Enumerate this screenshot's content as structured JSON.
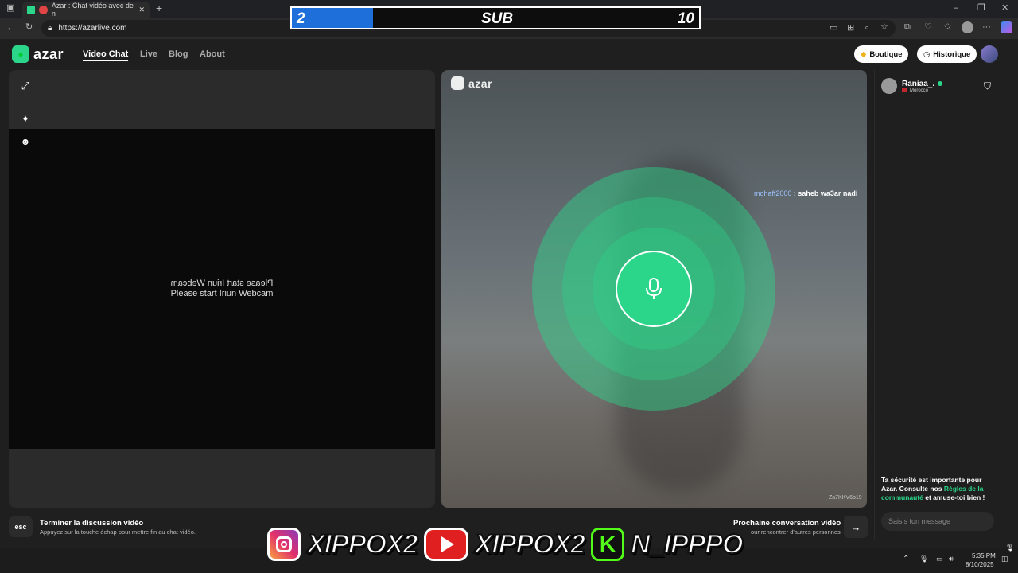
{
  "browser": {
    "tab_title": "Azar : Chat vidéo avec de n",
    "url": "https://azarlive.com"
  },
  "sub_counter": {
    "current": "2",
    "label": "SUB",
    "goal": "10",
    "progress": 0.2
  },
  "header": {
    "logo": "azar",
    "nav": [
      "Video Chat",
      "Live",
      "Blog",
      "About"
    ],
    "boutique_label": "Boutique",
    "historique_label": "Historique"
  },
  "left_panel": {
    "webcam_text_mirrored": "Please start Iriun Webcam",
    "webcam_text": "Please start Iriun Webcam"
  },
  "video": {
    "watermark": "azar",
    "chat_user": "mohaff2000",
    "chat_message": ": saheb wa3ar nadi",
    "code": "Za7KKV6b19",
    "accent": "#2bd68a"
  },
  "chat": {
    "partner_name": "Raniaa_.",
    "partner_country": "Morocco",
    "safety_prefix": "Ta sécurité est importante pour Azar. Consulte nos ",
    "safety_link": "Règles de la communauté",
    "safety_suffix": " et amuse-toi bien !",
    "input_placeholder": "Saisis ton message"
  },
  "hints": {
    "esc_key": "esc",
    "end_title": "Terminer la discussion vidéo",
    "end_sub": "Appuyez sur la touche échap pour mettre fin au chat vidéo.",
    "next_title": "Prochaine conversation vidéo",
    "next_sub": "our rencontrer d'autres personnes"
  },
  "social": {
    "instagram": "XIPPOX2",
    "youtube": "XIPPOX2",
    "kick": "N_IPPPO"
  },
  "taskbar": {
    "time": "5:35 PM",
    "date": "8/10/2025"
  }
}
